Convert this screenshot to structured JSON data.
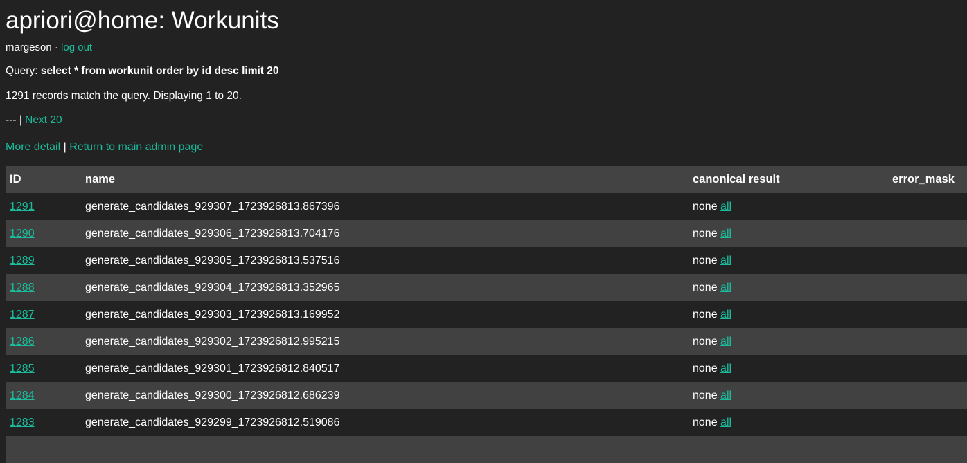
{
  "header": {
    "title": "apriori@home: Workunits",
    "username": "margeson",
    "user_separator": "·",
    "logout_label": "log out"
  },
  "query": {
    "label": "Query:",
    "sql": "select * from workunit order by id desc limit 20"
  },
  "status": {
    "records_line": "1291 records match the query. Displaying 1 to 20.",
    "record_count": 1291,
    "display_from": 1,
    "display_to": 20
  },
  "pager": {
    "prev_label": "---",
    "separator": "|",
    "next_label": "Next 20"
  },
  "admin_links": {
    "more_detail_label": "More detail",
    "separator": "|",
    "return_label": "Return to main admin page"
  },
  "table": {
    "columns": [
      {
        "key": "id",
        "label": "ID"
      },
      {
        "key": "name",
        "label": "name"
      },
      {
        "key": "canonical_result",
        "label": "canonical result"
      },
      {
        "key": "error_mask",
        "label": "error_mask"
      }
    ],
    "all_link_label": "all",
    "canonical_none_label": "none",
    "rows": [
      {
        "id": "1291",
        "name": "generate_candidates_929307_1723926813.867396",
        "canonical_result": "none",
        "all_link": "all",
        "error_mask": ""
      },
      {
        "id": "1290",
        "name": "generate_candidates_929306_1723926813.704176",
        "canonical_result": "none",
        "all_link": "all",
        "error_mask": ""
      },
      {
        "id": "1289",
        "name": "generate_candidates_929305_1723926813.537516",
        "canonical_result": "none",
        "all_link": "all",
        "error_mask": ""
      },
      {
        "id": "1288",
        "name": "generate_candidates_929304_1723926813.352965",
        "canonical_result": "none",
        "all_link": "all",
        "error_mask": ""
      },
      {
        "id": "1287",
        "name": "generate_candidates_929303_1723926813.169952",
        "canonical_result": "none",
        "all_link": "all",
        "error_mask": ""
      },
      {
        "id": "1286",
        "name": "generate_candidates_929302_1723926812.995215",
        "canonical_result": "none",
        "all_link": "all",
        "error_mask": ""
      },
      {
        "id": "1285",
        "name": "generate_candidates_929301_1723926812.840517",
        "canonical_result": "none",
        "all_link": "all",
        "error_mask": ""
      },
      {
        "id": "1284",
        "name": "generate_candidates_929300_1723926812.686239",
        "canonical_result": "none",
        "all_link": "all",
        "error_mask": ""
      },
      {
        "id": "1283",
        "name": "generate_candidates_929299_1723926812.519086",
        "canonical_result": "none",
        "all_link": "all",
        "error_mask": ""
      },
      {
        "id": "",
        "name": "",
        "canonical_result": "",
        "all_link": "",
        "error_mask": ""
      }
    ]
  },
  "colors": {
    "background": "#222222",
    "row_alt": "#414141",
    "header_row": "#434343",
    "link": "#1abc9c",
    "text": "#ffffff"
  }
}
